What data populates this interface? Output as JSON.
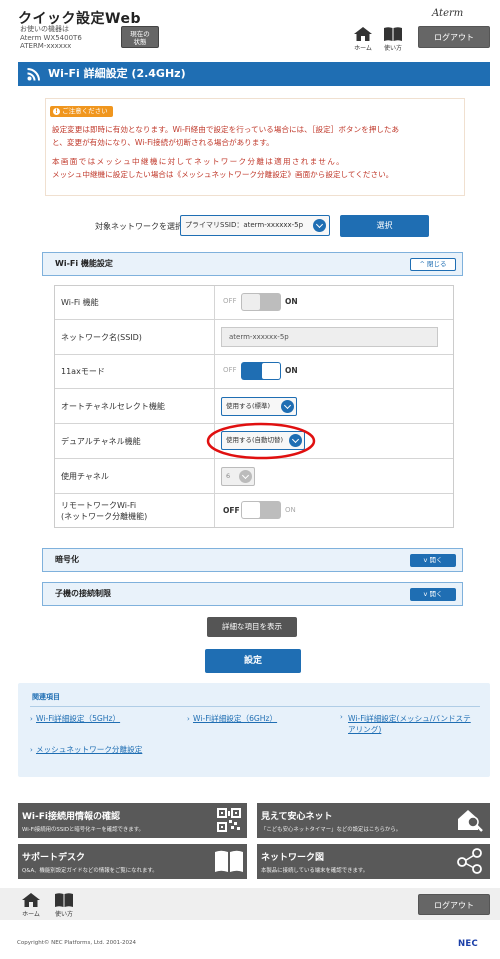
{
  "header": {
    "app_title": "クイック設定Web",
    "device_label": "お使いの機器は",
    "device_model": "Aterm WX5400T6",
    "device_name": "ATERM-xxxxxx",
    "status_button": "現在の\n状態",
    "brand": "Aterm",
    "home_label": "ホーム",
    "help_label": "使い方",
    "logout_label": "ログアウト"
  },
  "page_title": "Wi-Fi 詳細設定 (2.4GHz)",
  "notice": {
    "badge": "ご注意ください",
    "line1": "設定変更は即時に有効となります。Wi-Fi経由で設定を行っている場合には、［設定］ボタンを押したあ",
    "line2": "と、変更が有効になり、Wi-Fi接続が切断される場合があります。",
    "line3": "本画面ではメッシュ中継機に対してネットワーク分離は適用されません。",
    "line4": "メッシュ中継機に設定したい場合は《メッシュネットワーク分離設定》画面から設定してください。"
  },
  "network_select": {
    "label": "対象ネットワークを選択",
    "value": "プライマリSSID：aterm-xxxxxx-5p",
    "button": "選択"
  },
  "wifi_section": {
    "title": "Wi-Fi 機能設定",
    "toggle_label": "閉じる",
    "rows": {
      "wifi": {
        "label": "Wi-Fi 機能",
        "off": "OFF",
        "on": "ON",
        "state": "on-gray"
      },
      "ssid": {
        "label": "ネットワーク名(SSID)",
        "value": "aterm-xxxxxx-5p"
      },
      "ax": {
        "label": "11axモード",
        "off": "OFF",
        "on": "ON",
        "state": "on"
      },
      "autochannel": {
        "label": "オートチャネルセレクト機能",
        "value": "使用する(標準)"
      },
      "dualchannel": {
        "label": "デュアルチャネル機能",
        "value": "使用する(自動切替)"
      },
      "channel": {
        "label": "使用チャネル",
        "value": "6"
      },
      "remote": {
        "label": "リモートワークWi-Fi\n(ネットワーク分離機能)",
        "off": "OFF",
        "on": "ON",
        "state": "off"
      }
    }
  },
  "encryption_section": {
    "title": "暗号化",
    "toggle_label": "開く"
  },
  "client_section": {
    "title": "子機の接続制限",
    "toggle_label": "開く"
  },
  "show_details_button": "詳細な項目を表示",
  "save_button": "設定",
  "related": {
    "title": "関連項目",
    "links": [
      "Wi-Fi詳細設定（5GHz）",
      "Wi-Fi詳細設定（6GHz）",
      "Wi-Fi詳細設定(メッシュ/バンドステ\nアリング)",
      "メッシュネットワーク分離設定"
    ]
  },
  "cards": [
    {
      "title": "Wi-Fi接続用情報の確認",
      "desc": "Wi-Fi接続用のSSIDと暗号化キーを確認できます。",
      "icon": "qr-code-icon"
    },
    {
      "title": "見えて安心ネット",
      "desc": "「こども安心ネットタイマー」などの設定はこちらから。",
      "icon": "house-search-icon"
    },
    {
      "title": "サポートデスク",
      "desc": "Q&A、機能別設定ガイドなどの情報をご覧になれます。",
      "icon": "book-icon"
    },
    {
      "title": "ネットワーク図",
      "desc": "本製品に接続している端末を確認できます。",
      "icon": "network-icon"
    }
  ],
  "footer": {
    "home_label": "ホーム",
    "help_label": "使い方",
    "logout_label": "ログアウト",
    "copyright": "Copyright© NEC Platforms, Ltd. 2001-2024",
    "logo": "NEC"
  },
  "colors": {
    "primary": "#1f6eb3",
    "notice_text": "#c0392b",
    "highlight_circle": "#e01010",
    "card_bg": "#595959"
  }
}
